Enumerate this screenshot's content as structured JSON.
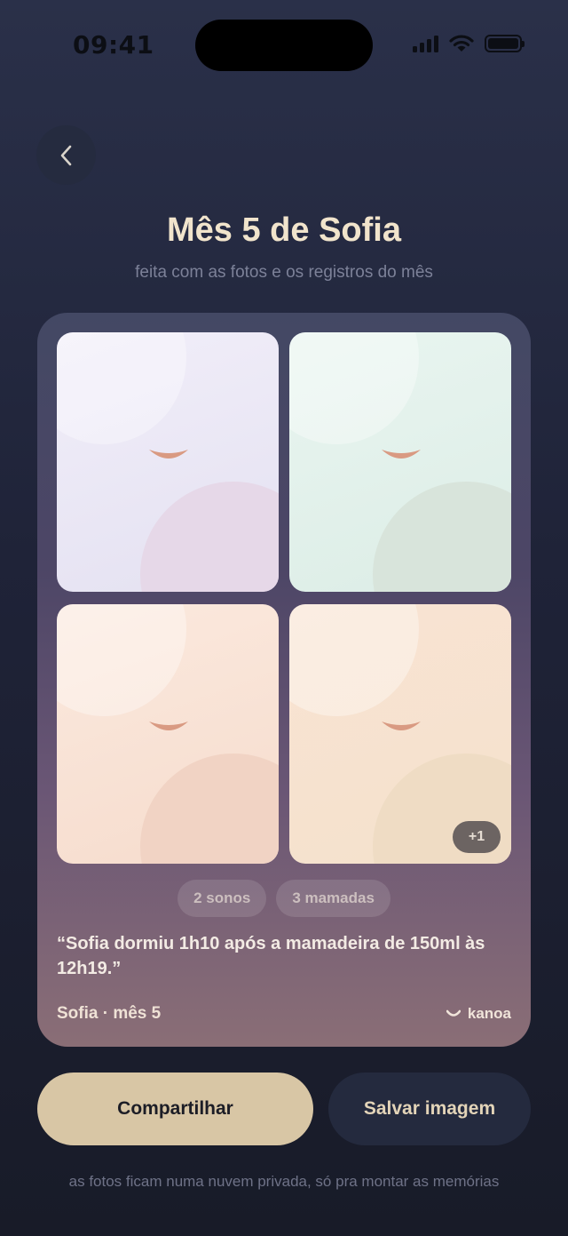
{
  "status_bar": {
    "time": "09:41"
  },
  "header": {
    "back_icon": "chevron-left-icon",
    "title": "Mês 5 de Sofia",
    "subtitle": "feita com as fotos e os registros do mês"
  },
  "card": {
    "photos": [
      {
        "tone": "#eae6f5"
      },
      {
        "tone": "#e2f1eb"
      },
      {
        "tone": "#f8e2d5"
      },
      {
        "tone": "#f6e2cf"
      }
    ],
    "more_badge": "+1",
    "chips": [
      "2 sonos",
      "3 mamadas"
    ],
    "quote": "“Sofia dormiu 1h10 após a mamadeira de 150ml às 12h19.”",
    "owner_label": "Sofia · mês 5",
    "brand": "kanoa"
  },
  "actions": {
    "share_label": "Compartilhar",
    "save_label": "Salvar imagem"
  },
  "footer": {
    "privacy_note": "as fotos ficam numa nuvem privada, só pra montar as memórias"
  },
  "colors": {
    "accent": "#d8c6a5",
    "background": "#1f2338",
    "smile": "#d99a82"
  }
}
